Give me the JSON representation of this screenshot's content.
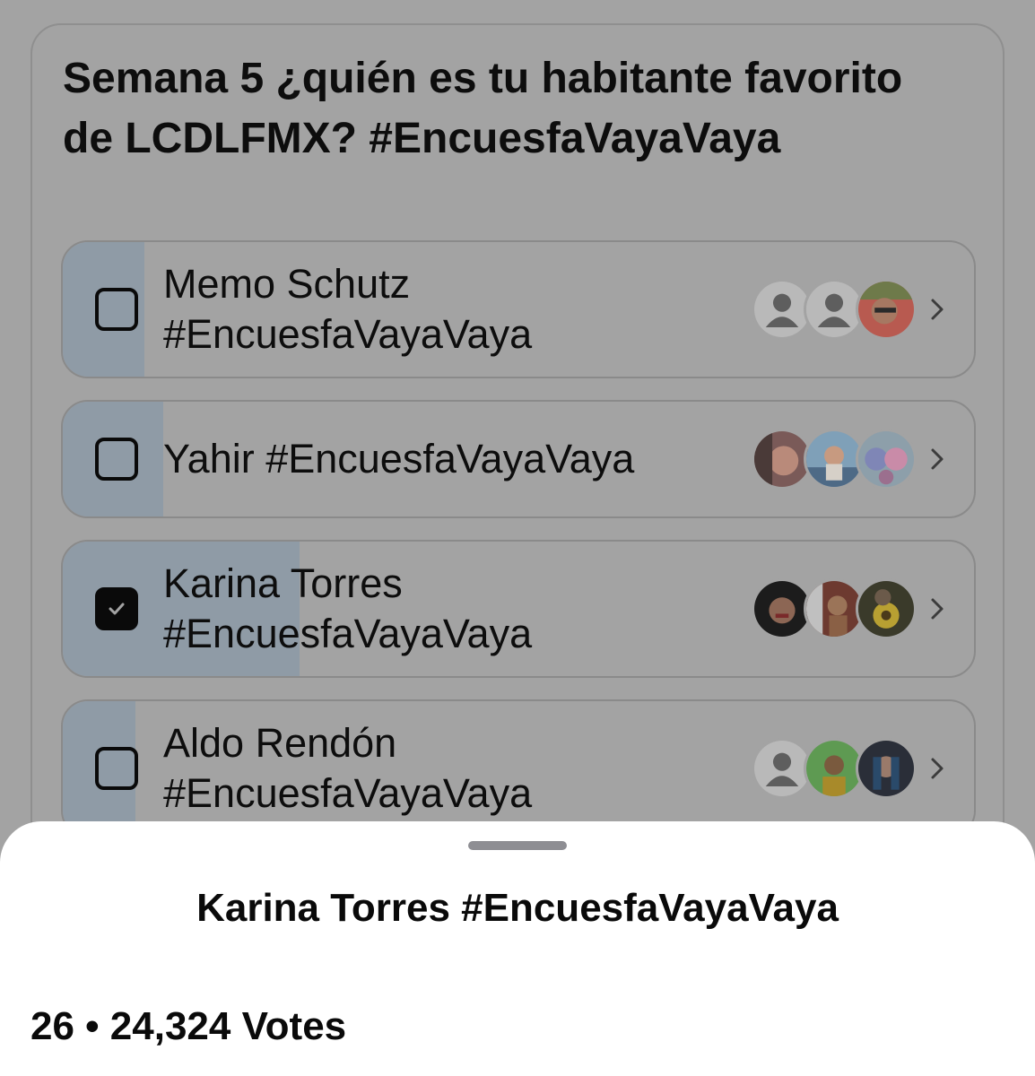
{
  "poll": {
    "question": "Semana 5 ¿quién es tu habitante favorito de LCDLFMX? #EncuesfaVayaVaya",
    "options": [
      {
        "label": "Memo Schutz #EncuesfaVayaVaya",
        "checked": false,
        "fill_fraction": 0.09,
        "voter_avatars": [
          "person-placeholder-icon",
          "person-placeholder-icon",
          "voter-photo"
        ]
      },
      {
        "label": "Yahir #EncuesfaVayaVaya",
        "checked": false,
        "fill_fraction": 0.11,
        "voter_avatars": [
          "voter-photo",
          "voter-photo",
          "voter-photo"
        ]
      },
      {
        "label": "Karina Torres #EncuesfaVayaVaya",
        "checked": true,
        "fill_fraction": 0.26,
        "voter_avatars": [
          "voter-photo",
          "voter-photo",
          "voter-photo"
        ]
      },
      {
        "label": "Aldo Rendón #EncuesfaVayaVaya",
        "checked": false,
        "fill_fraction": 0.08,
        "voter_avatars": [
          "person-placeholder-icon",
          "voter-photo",
          "voter-photo"
        ]
      }
    ]
  },
  "sheet": {
    "title": "Karina Torres #EncuesfaVayaVaya",
    "meta": "26 • 24,324 Votes"
  },
  "colors": {
    "dimmed_background": "#a3a3a3",
    "result_fill": "#8f9ba6",
    "sheet_background": "#ffffff"
  }
}
